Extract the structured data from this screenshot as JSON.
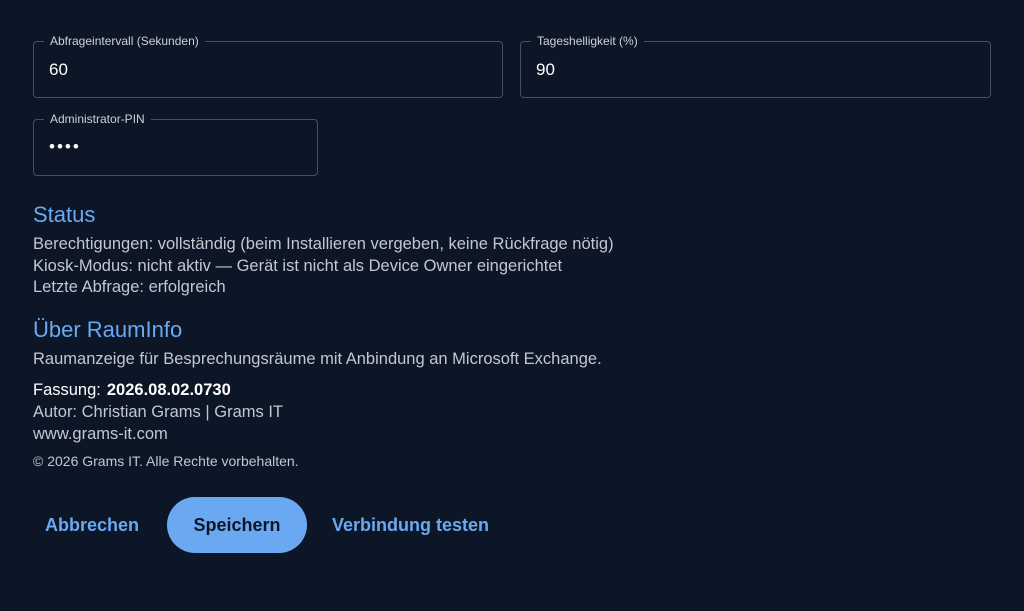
{
  "fields": {
    "interval": {
      "label": "Abfrageintervall (Sekunden)",
      "value": "60"
    },
    "brightness": {
      "label": "Tageshelligkeit (%)",
      "value": "90"
    },
    "pin": {
      "label": "Administrator-PIN",
      "value": "••••"
    }
  },
  "status": {
    "title": "Status",
    "permissions": "Berechtigungen: vollständig (beim Installieren vergeben, keine Rückfrage nötig)",
    "kiosk": "Kiosk-Modus: nicht aktiv — Gerät ist nicht als Device Owner eingerichtet",
    "last_query": "Letzte Abfrage: erfolgreich"
  },
  "about": {
    "title": "Über RaumInfo",
    "description": "Raumanzeige für Besprechungsräume mit Anbindung an Microsoft Exchange.",
    "version_label": "Fassung:",
    "version_value": "2026.08.02.0730",
    "author": "Autor: Christian Grams | Grams IT",
    "website": "www.grams-it.com",
    "copyright": "© 2026 Grams IT. Alle Rechte vorbehalten."
  },
  "actions": {
    "cancel": "Abbrechen",
    "save": "Speichern",
    "test": "Verbindung testen"
  },
  "colors": {
    "background": "#0d1626",
    "accent": "#6aa9f2",
    "field_border": "#46505e"
  }
}
